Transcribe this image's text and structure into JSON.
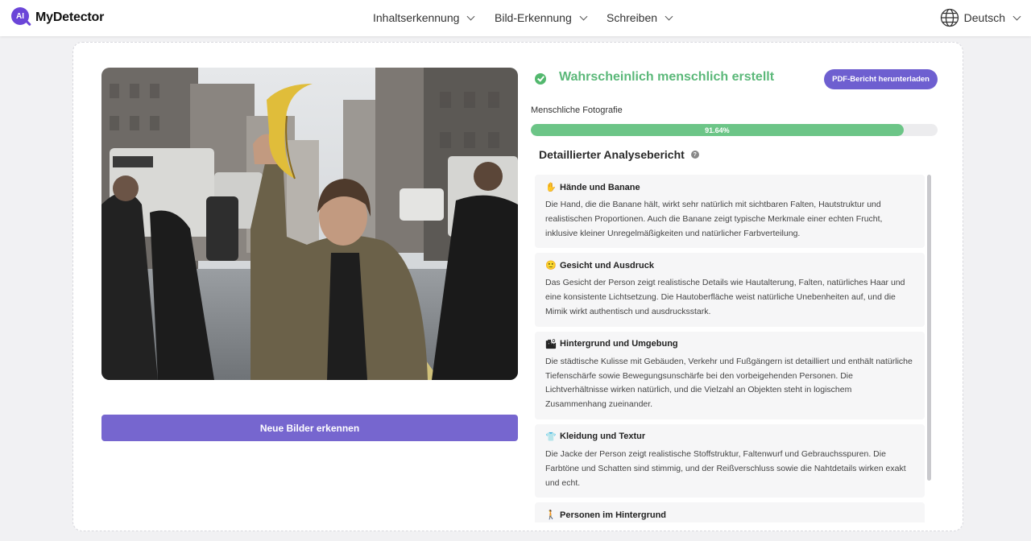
{
  "header": {
    "brand": "MyDetector",
    "logo_mark": "AI",
    "nav": [
      {
        "label": "Inhaltserkennung"
      },
      {
        "label": "Bild-Erkennung"
      },
      {
        "label": "Schreiben"
      }
    ],
    "language": "Deutsch"
  },
  "result": {
    "verdict": "Wahrscheinlich menschlich erstellt",
    "pdf_button": "PDF-Bericht herunterladen",
    "category": "Menschliche Fotografie",
    "confidence_text": "91.64%",
    "confidence_value": 91.64
  },
  "report": {
    "title": "Detaillierter Analysebericht",
    "help": "?",
    "sections": [
      {
        "icon": "✋",
        "icon_name": "hand-icon",
        "title": "Hände und Banane",
        "body": "Die Hand, die die Banane hält, wirkt sehr natürlich mit sichtbaren Falten, Hautstruktur und realistischen Proportionen. Auch die Banane zeigt typische Merkmale einer echten Frucht, inklusive kleiner Unregelmäßigkeiten und natürlicher Farbverteilung."
      },
      {
        "icon": "🙂",
        "icon_name": "face-icon",
        "title": "Gesicht und Ausdruck",
        "body": "Das Gesicht der Person zeigt realistische Details wie Hautalterung, Falten, natürliches Haar und eine konsistente Lichtsetzung. Die Hautoberfläche weist natürliche Unebenheiten auf, und die Mimik wirkt authentisch und ausdrucksstark."
      },
      {
        "icon": "🏙",
        "icon_name": "cityscape-icon",
        "title": "Hintergrund und Umgebung",
        "body": "Die städtische Kulisse mit Gebäuden, Verkehr und Fußgängern ist detailliert und enthält natürliche Tiefenschärfe sowie Bewegungsunschärfe bei den vorbeigehenden Personen. Die Lichtverhältnisse wirken natürlich, und die Vielzahl an Objekten steht in logischem Zusammenhang zueinander."
      },
      {
        "icon": "👕",
        "icon_name": "clothing-icon",
        "title": "Kleidung und Textur",
        "body": "Die Jacke der Person zeigt realistische Stoffstruktur, Faltenwurf und Gebrauchsspuren. Die Farbtöne und Schatten sind stimmig, und der Reißverschluss sowie die Nahtdetails wirken exakt und echt."
      },
      {
        "icon": "🚶",
        "icon_name": "walking-person-icon",
        "title": "Personen im Hintergrund",
        "body": ""
      }
    ]
  },
  "actions": {
    "new_images": "Neue Bilder erkennen"
  },
  "colors": {
    "brand": "#6b45d8",
    "button": "#7666cf",
    "success": "#5bb879",
    "progress": "#6cc587"
  }
}
